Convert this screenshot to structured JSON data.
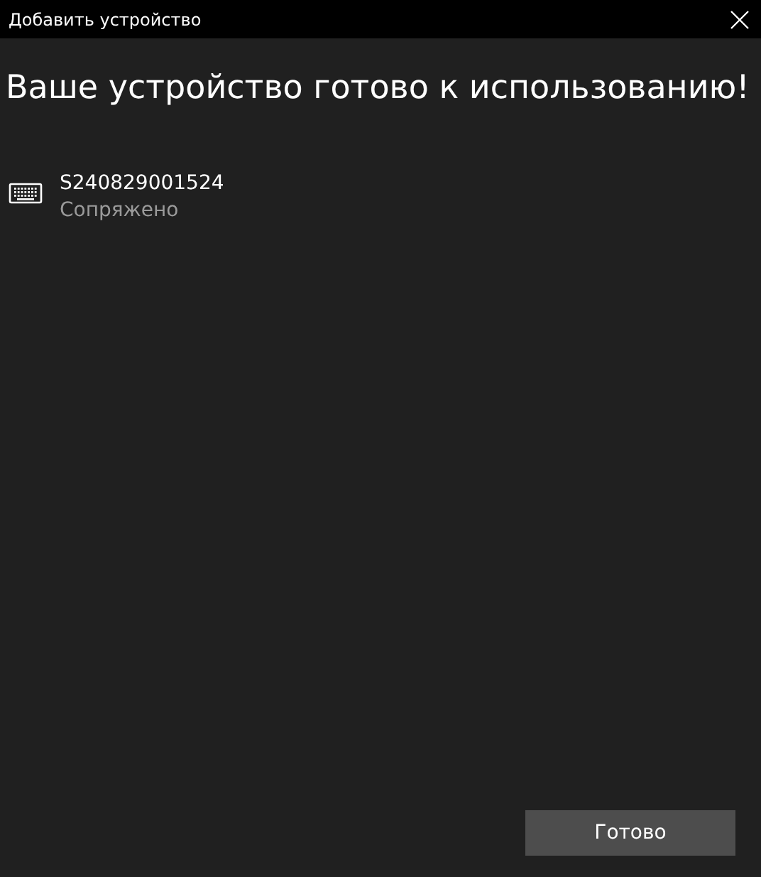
{
  "window": {
    "title": "Добавить устройство"
  },
  "heading": "Ваше устройство готово к использованию!",
  "devices": [
    {
      "name": "S240829001524",
      "status": "Сопряжено"
    }
  ],
  "buttons": [
    "Готово"
  ]
}
